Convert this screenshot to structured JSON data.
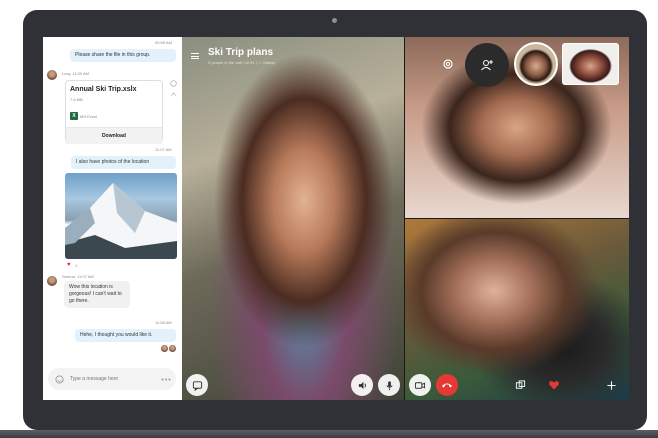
{
  "chat": {
    "msg1": {
      "time": "00:59 AM",
      "text": "Please share the file in this group."
    },
    "msg2": {
      "sender_time": "Lucy, 11:00 AM",
      "file_name": "Annual Ski Trip.xslx",
      "file_size": "7.6 MB",
      "file_type": "MS Excel",
      "download_label": "Download"
    },
    "msg3": {
      "time": "11:07 AM",
      "text": "I also have photos of the location"
    },
    "msg3_reaction_count": "1",
    "msg4": {
      "sender_time": "Serena, 11:07 AM",
      "text": "Wow this location is gorgeous! I can't wait to go there."
    },
    "msg5": {
      "time": "11:08 AM",
      "text": "Hehe, I thought you would like it."
    },
    "compose_placeholder": "Type a message here"
  },
  "call": {
    "title": "Ski Trip plans",
    "subtitle": "3 people in the call | 02:31 | ☆ Gallery"
  },
  "icons": {
    "excel_glyph": "X",
    "menu": "hamburger-icon",
    "settings": "gear-icon",
    "add_person": "add-person-icon",
    "chat_toggle": "chat-bubble-icon",
    "speaker": "speaker-icon",
    "mic": "microphone-icon",
    "video": "video-camera-icon",
    "end_call": "end-call-icon",
    "screen_share": "screen-share-icon",
    "heart": "heart-icon",
    "more": "plus-icon"
  },
  "colors": {
    "accent_bubble": "#e3f1fb",
    "end_call": "#e53935",
    "heart": "#e53935"
  }
}
